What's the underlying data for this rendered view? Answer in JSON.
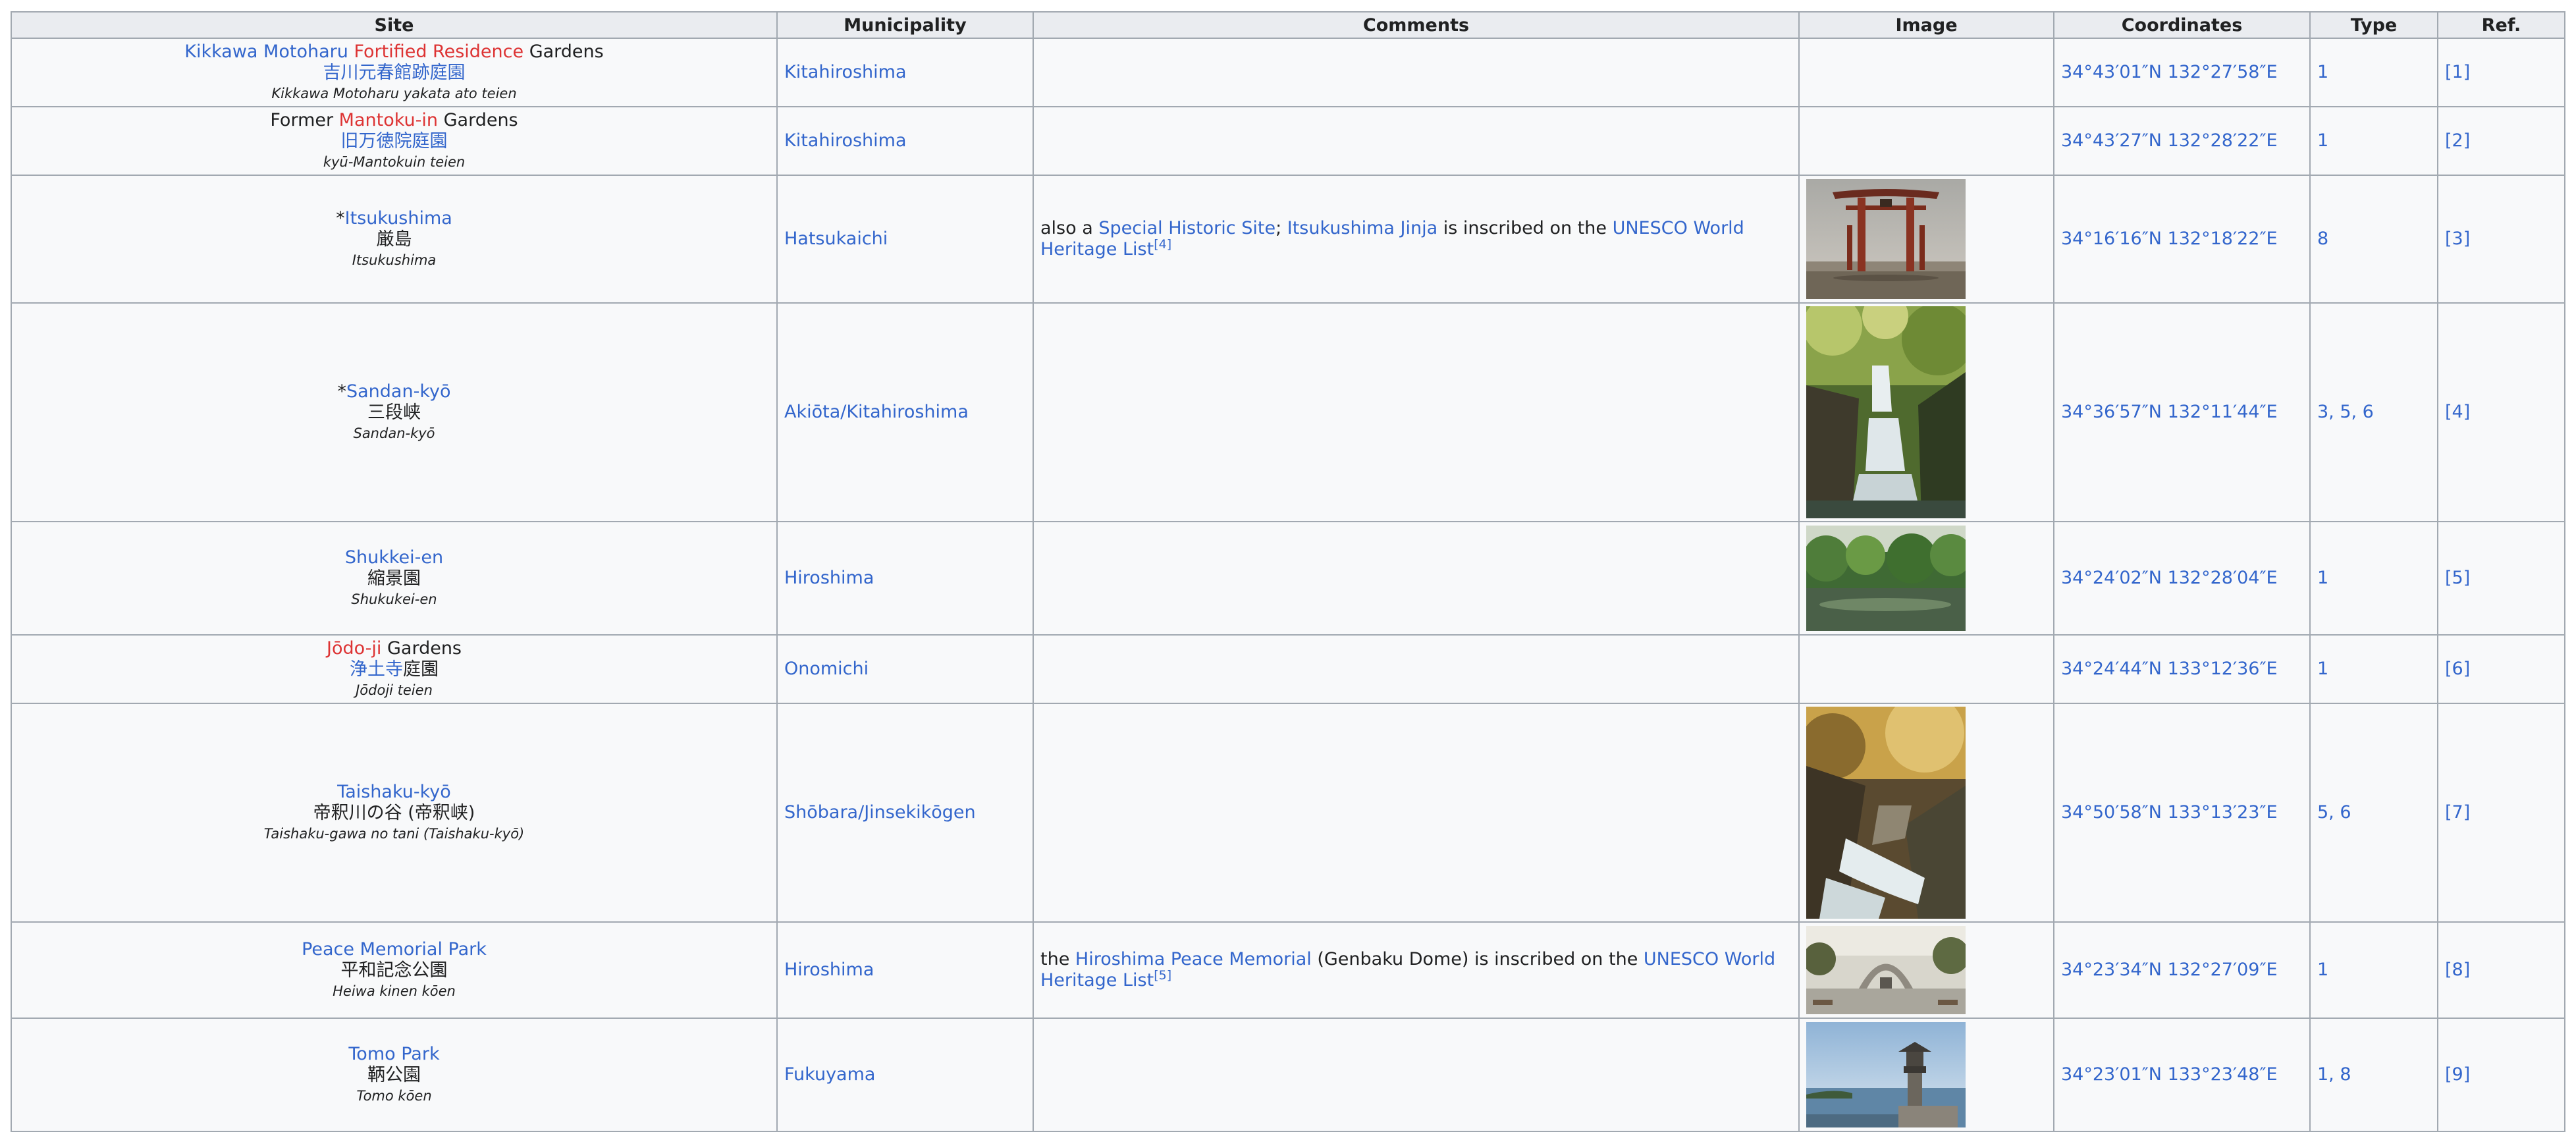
{
  "headers": {
    "site": "Site",
    "municipality": "Municipality",
    "comments": "Comments",
    "image": "Image",
    "coordinates": "Coordinates",
    "type": "Type",
    "ref": "Ref."
  },
  "rows": [
    {
      "site": {
        "p1": "Kikkawa Motoharu",
        "p2": " ",
        "p3": "Fortified Residence",
        "p4": " Gardens",
        "ja1": "吉川元春館跡庭園",
        "ja2": "",
        "romaji": "Kikkawa Motoharu yakata ato teien"
      },
      "municipality": "Kitahiroshima",
      "comments": {},
      "image": "none",
      "coordinates": "34°43′01″N 132°27′58″E",
      "type": "1",
      "ref": "[1]"
    },
    {
      "site": {
        "p1": "Former ",
        "p2": "Mantoku-in",
        "p3": " Gardens",
        "ja1": "旧万徳院庭園",
        "ja2": "",
        "romaji": "kyū-Mantokuin teien"
      },
      "municipality": "Kitahiroshima",
      "comments": {},
      "image": "none",
      "coordinates": "34°43′27″N 132°28′22″E",
      "type": "1",
      "ref": "[2]"
    },
    {
      "site": {
        "p1": "*",
        "p2": "Itsukushima",
        "ja1": "",
        "ja2": "厳島",
        "romaji": "Itsukushima"
      },
      "municipality": "Hatsukaichi",
      "comments": {
        "t1": "also a ",
        "t2": "Special Historic Site",
        "t3": "; ",
        "t4": "Itsukushima Jinja",
        "t5": " is inscribed on the ",
        "t6": "UNESCO World Heritage List",
        "t7": "[4]"
      },
      "image": "torii-gate",
      "coordinates": "34°16′16″N 132°18′22″E",
      "type": "8",
      "ref": "[3]"
    },
    {
      "site": {
        "p1": "*",
        "p2": "Sandan-kyō",
        "ja1": "",
        "ja2": "三段峡",
        "romaji": "Sandan-kyō"
      },
      "municipality": "Akiōta/Kitahiroshima",
      "comments": {},
      "image": "waterfall-gorge",
      "coordinates": "34°36′57″N 132°11′44″E",
      "type": "3, 5, 6",
      "ref": "[4]"
    },
    {
      "site": {
        "p1": "Shukkei-en",
        "ja1": "",
        "ja2": "縮景園",
        "romaji": "Shukukei-en"
      },
      "municipality": "Hiroshima",
      "comments": {},
      "image": "garden-pond",
      "coordinates": "34°24′02″N 132°28′04″E",
      "type": "1",
      "ref": "[5]"
    },
    {
      "site": {
        "p1": "Jōdo-ji",
        "p2": " Gardens",
        "ja1": "浄土寺",
        "ja2": "庭園",
        "romaji": "Jōdoji teien"
      },
      "municipality": "Onomichi",
      "comments": {},
      "image": "none",
      "coordinates": "34°24′44″N 133°12′36″E",
      "type": "1",
      "ref": "[6]"
    },
    {
      "site": {
        "p1": "Taishaku-kyō",
        "ja1": "",
        "ja2": "帝釈川の谷 (帝釈峡)",
        "romaji": "Taishaku-gawa no tani (Taishaku-kyō)"
      },
      "municipality": "Shōbara/Jinsekikōgen",
      "comments": {},
      "image": "autumn-stream",
      "coordinates": "34°50′58″N 133°13′23″E",
      "type": "5, 6",
      "ref": "[7]"
    },
    {
      "site": {
        "p1": "Peace Memorial Park",
        "ja1": "",
        "ja2": "平和記念公園",
        "romaji": "Heiwa kinen kōen"
      },
      "municipality": "Hiroshima",
      "comments": {
        "t1": "the ",
        "t2": "Hiroshima Peace Memorial",
        "t3": " (Genbaku Dome) is inscribed on the ",
        "t4": "UNESCO World Heritage List",
        "t5": "[5]"
      },
      "image": "memorial-cenotaph",
      "coordinates": "34°23′34″N 132°27′09″E",
      "type": "1",
      "ref": "[8]"
    },
    {
      "site": {
        "p1": "Tomo Park",
        "ja1": "",
        "ja2": "鞆公園",
        "romaji": "Tomo kōen"
      },
      "municipality": "Fukuyama",
      "comments": {},
      "image": "stone-lantern-harbor",
      "coordinates": "34°23′01″N 133°23′48″E",
      "type": "1, 8",
      "ref": "[9]"
    }
  ]
}
